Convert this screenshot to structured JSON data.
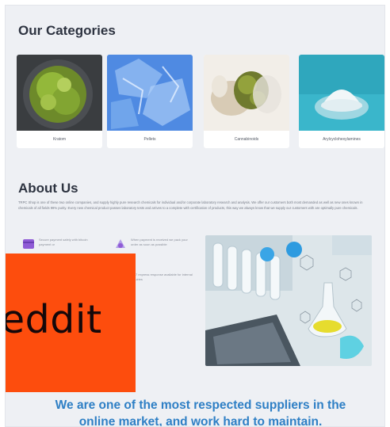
{
  "categories": {
    "title": "Our Categories",
    "items": [
      {
        "label": "Kratom"
      },
      {
        "label": "Pellets"
      },
      {
        "label": "Cannabinoids"
      },
      {
        "label": "Arylcyclohexylamines"
      }
    ]
  },
  "about": {
    "title": "About Us",
    "text": "TRPC Shop is one of these two online companies, and supply highly pure research chemicals for individual and/or corporate laboratory research and analysis. We offer our customers both most demanded as well as new ones known in chemicals of all fields 99% purity. Every new chemical product passes laboratory tests and arrives to a complete with certification of products, this way we always know that we supply our customers with are optimally pure chemicals.",
    "features": [
      {
        "icon": "payment-card-icon",
        "text": "Secure payment safely with bitcoin payment or",
        "color": "#8f5bd6"
      },
      {
        "icon": "delivery-icon",
        "text": "When payment is received we pack your order as soon as possible",
        "color": "#8f5bd6"
      },
      {
        "icon": "support-icon",
        "text": "24*7 express response available for internal inquiries",
        "color": "#8f5bd6"
      }
    ]
  },
  "ad": {
    "text": "eddit",
    "color": "#fd4d0d"
  },
  "tagline": {
    "line1": "We are one of the most respected suppliers in the",
    "line2": "online market, and work hard to maintain."
  }
}
